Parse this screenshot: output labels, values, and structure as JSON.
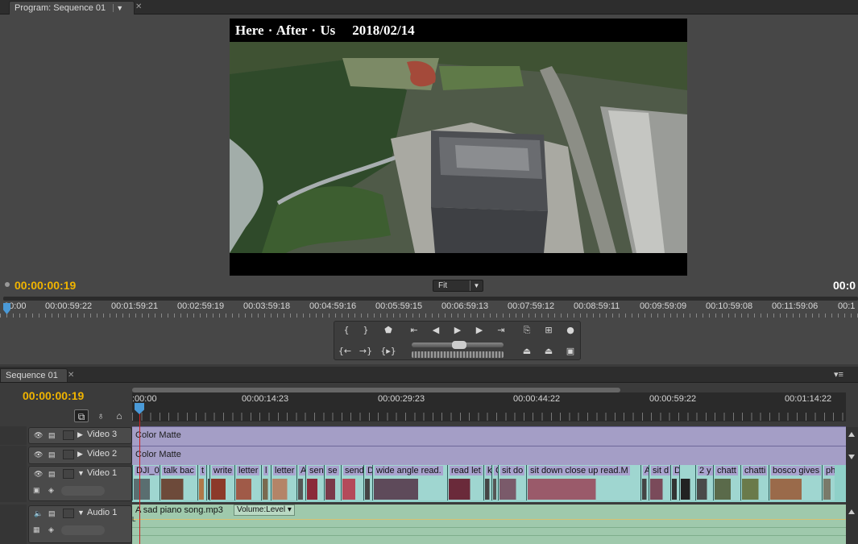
{
  "program_monitor": {
    "tab_label": "Program: Sequence 01",
    "tab_menu_icon": "chevron-down-icon",
    "frame_title": "Here · After · Us    2018/02/14",
    "timecode_left": "00:00:00:19",
    "timecode_right": "00:0",
    "zoom_select": "Fit",
    "ruler_labels": [
      "00:00",
      "00:00:59:22",
      "00:01:59:21",
      "00:02:59:19",
      "00:03:59:18",
      "00:04:59:16",
      "00:05:59:15",
      "00:06:59:13",
      "00:07:59:12",
      "00:08:59:11",
      "00:09:59:09",
      "00:10:59:08",
      "00:11:59:06",
      "00:1"
    ],
    "transport_icons": [
      "mark-in-icon",
      "mark-out-icon",
      "marker-icon",
      "go-to-in-icon",
      "step-back-icon",
      "play-icon",
      "step-forward-icon",
      "go-to-out-icon",
      "insert-icon",
      "safe-margins-icon",
      "output-icon",
      "play-in-to-out-icon",
      "loop-icon",
      "play-around-icon",
      "lift-icon",
      "extract-icon",
      "export-frame-icon"
    ]
  },
  "sequence_panel": {
    "tab_label": "Sequence 01",
    "timecode": "00:00:00:19",
    "ruler_labels": [
      ":00:00",
      "00:00:14:23",
      "00:00:29:23",
      "00:00:44:22",
      "00:00:59:22",
      "00:01:14:22"
    ],
    "tracks": {
      "video3": {
        "name": "Video 3",
        "clip": "Color Matte"
      },
      "video2": {
        "name": "Video 2",
        "clip": "Color Matte"
      },
      "video1": {
        "name": "Video 1",
        "clips": [
          "DJI_0",
          "talk bac",
          "t",
          "",
          "write",
          "letter",
          "l",
          "letter",
          "A",
          "sen",
          "se",
          "send",
          "D",
          "wide angle read.",
          "read let",
          "k",
          "C",
          "sit do",
          "sit down close up read.M",
          "A",
          "sit d",
          "D",
          "",
          "2 y",
          "chatt",
          "chatti",
          "bosco gives",
          "ph"
        ]
      },
      "audio1": {
        "name": "Audio 1",
        "clip": "A sad piano song.mp3",
        "volume": "Volume:Level"
      }
    }
  },
  "colors": {
    "timecode_accent": "#f0b400",
    "matte_clip": "#a49ec6",
    "video_clip": "#9fd6d0",
    "audio_clip": "#9fc9ac",
    "playhead": "#d02020"
  }
}
